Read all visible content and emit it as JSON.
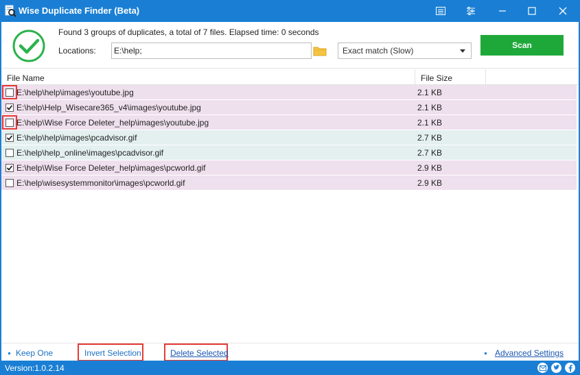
{
  "window": {
    "title": "Wise Duplicate Finder (Beta)"
  },
  "summary": {
    "text": "Found 3 groups of duplicates, a total of 7 files. Elapsed time: 0 seconds",
    "locations_label": "Locations:",
    "location_value": "E:\\help;"
  },
  "match_mode": {
    "selected": "Exact match (Slow)"
  },
  "scan_button": {
    "label": "Scan"
  },
  "table": {
    "headers": {
      "name": "File Name",
      "size": "File Size"
    },
    "rows": [
      {
        "name": "E:\\help\\help\\images\\youtube.jpg",
        "size": "2.1 KB",
        "checked": false,
        "group": 1
      },
      {
        "name": "E:\\help\\Help_Wisecare365_v4\\images\\youtube.jpg",
        "size": "2.1 KB",
        "checked": true,
        "group": 1
      },
      {
        "name": "E:\\help\\Wise Force Deleter_help\\images\\youtube.jpg",
        "size": "2.1 KB",
        "checked": false,
        "group": 1
      },
      {
        "name": "E:\\help\\help\\images\\pcadvisor.gif",
        "size": "2.7 KB",
        "checked": true,
        "group": 2
      },
      {
        "name": "E:\\help\\help_online\\images\\pcadvisor.gif",
        "size": "2.7 KB",
        "checked": false,
        "group": 2
      },
      {
        "name": "E:\\help\\Wise Force Deleter_help\\images\\pcworld.gif",
        "size": "2.9 KB",
        "checked": true,
        "group": 3
      },
      {
        "name": "E:\\help\\wisesystemmonitor\\images\\pcworld.gif",
        "size": "2.9 KB",
        "checked": false,
        "group": 3
      }
    ]
  },
  "actions": {
    "keep_one": "Keep One",
    "invert_selection": "Invert Selection",
    "delete_selected": "Delete Selected",
    "advanced_settings": "Advanced Settings"
  },
  "status": {
    "version": "Version:1.0.2.14"
  },
  "colors": {
    "accent": "#1a7fd4",
    "scan_green": "#1fa83a",
    "group_pink": "#efe0ee",
    "group_teal": "#e3f0ef",
    "highlight_red": "#e53935"
  },
  "icons": [
    "app-icon",
    "menu-icon",
    "settings-icon",
    "minimize-icon",
    "maximize-icon",
    "close-icon",
    "check-circle-icon",
    "folder-icon",
    "dropdown-arrow-icon",
    "checkmark-icon",
    "mail-icon",
    "twitter-icon",
    "facebook-icon"
  ]
}
